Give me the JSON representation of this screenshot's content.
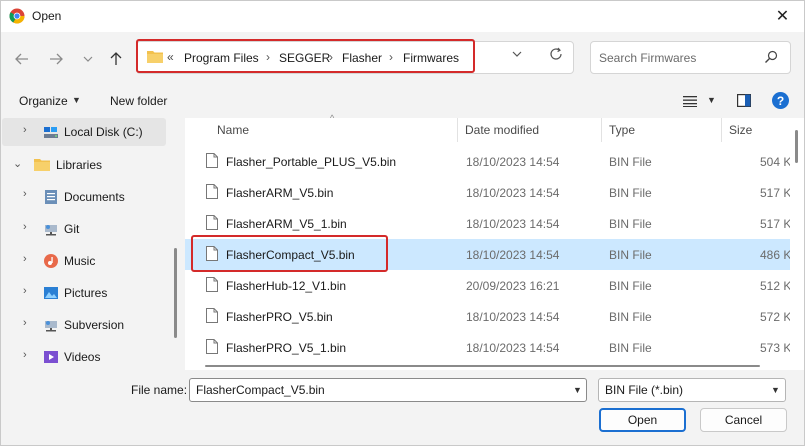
{
  "window": {
    "title": "Open",
    "app_icon": "chrome-icon",
    "close_glyph": "✕"
  },
  "nav": {
    "back_icon": "arrow-left-icon",
    "forward_icon": "arrow-right-icon",
    "recent_icon": "chevron-down-icon",
    "up_icon": "arrow-up-icon",
    "overflow": "«",
    "breadcrumbs": [
      "Program Files",
      "SEGGER",
      "Flasher",
      "Firmwares"
    ],
    "search_placeholder": "Search Firmwares"
  },
  "toolbar": {
    "organize": "Organize",
    "new_folder": "New folder",
    "help": "?"
  },
  "sidebar": {
    "items": [
      {
        "label": "Local Disk (C:)",
        "icon": "drive-icon",
        "selected": true
      },
      {
        "label": "Libraries",
        "icon": "folder-icon",
        "expanded": true
      },
      {
        "label": "Documents",
        "icon": "documents-icon"
      },
      {
        "label": "Git",
        "icon": "network-folder-icon"
      },
      {
        "label": "Music",
        "icon": "music-icon"
      },
      {
        "label": "Pictures",
        "icon": "pictures-icon"
      },
      {
        "label": "Subversion",
        "icon": "network-folder-icon"
      },
      {
        "label": "Videos",
        "icon": "videos-icon"
      }
    ]
  },
  "filelist": {
    "columns": [
      "Name",
      "Date modified",
      "Type",
      "Size"
    ],
    "rows": [
      {
        "name": "Flasher_Portable_PLUS_V5.bin",
        "date": "18/10/2023 14:54",
        "type": "BIN File",
        "size": "504 K"
      },
      {
        "name": "FlasherARM_V5.bin",
        "date": "18/10/2023 14:54",
        "type": "BIN File",
        "size": "517 K"
      },
      {
        "name": "FlasherARM_V5_1.bin",
        "date": "18/10/2023 14:54",
        "type": "BIN File",
        "size": "517 K"
      },
      {
        "name": "FlasherCompact_V5.bin",
        "date": "18/10/2023 14:54",
        "type": "BIN File",
        "size": "486 K",
        "selected": true
      },
      {
        "name": "FlasherHub-12_V1.bin",
        "date": "20/09/2023 16:21",
        "type": "BIN File",
        "size": "512 K"
      },
      {
        "name": "FlasherPRO_V5.bin",
        "date": "18/10/2023 14:54",
        "type": "BIN File",
        "size": "572 K"
      },
      {
        "name": "FlasherPRO_V5_1.bin",
        "date": "18/10/2023 14:54",
        "type": "BIN File",
        "size": "573 K"
      }
    ]
  },
  "bottom": {
    "file_name_label": "File name:",
    "file_name_value": "FlasherCompact_V5.bin",
    "filter": "BIN File (*.bin)",
    "open": "Open",
    "cancel": "Cancel"
  },
  "colors": {
    "accent": "#1b6fd1",
    "highlight": "#d42a2a",
    "selection": "#cce8ff"
  }
}
